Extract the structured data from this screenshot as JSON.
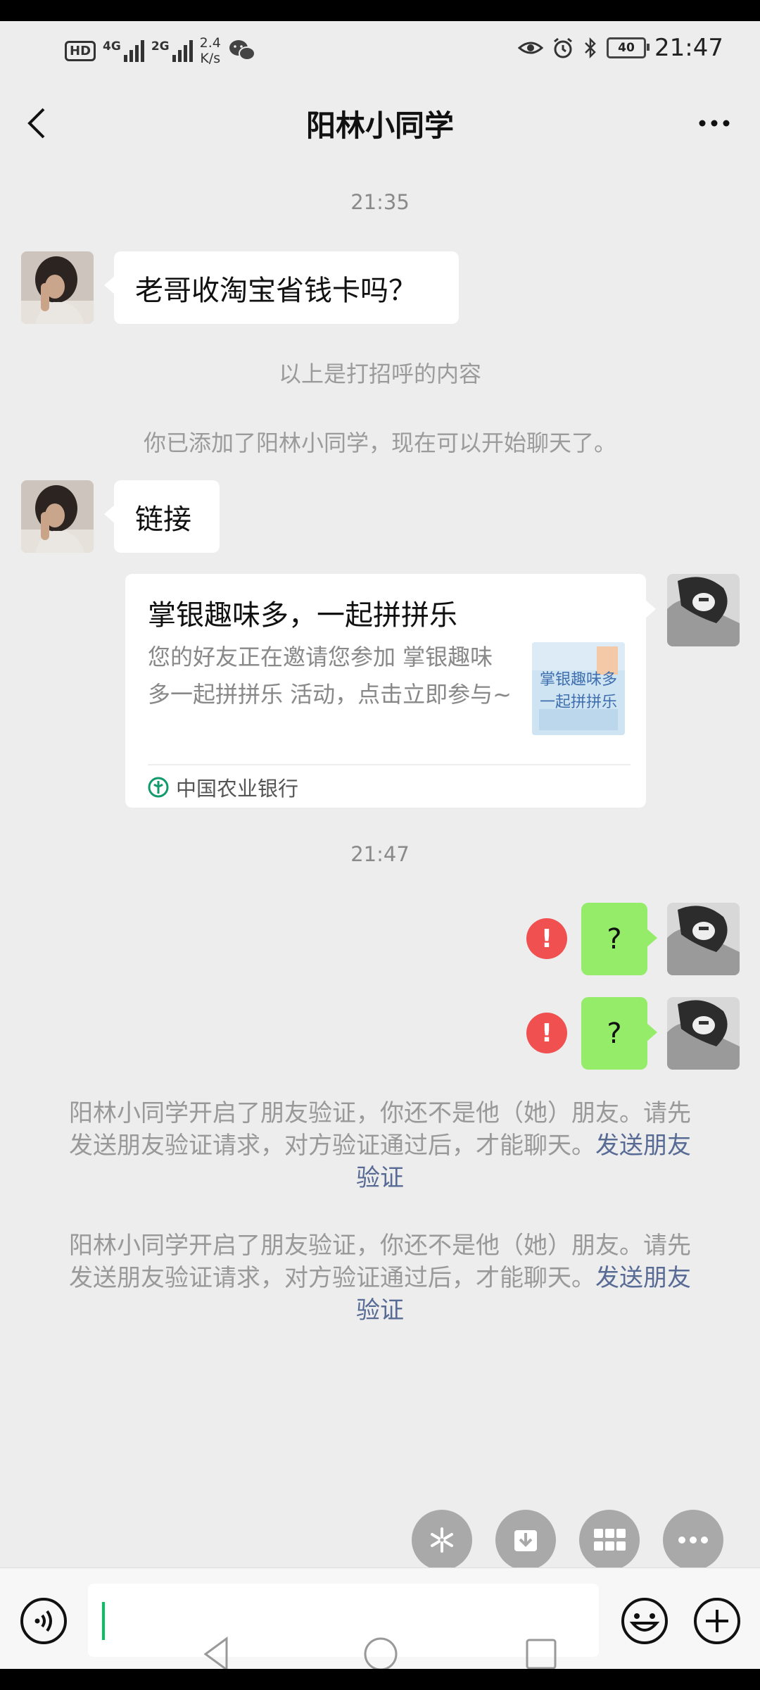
{
  "status_bar": {
    "hd": "HD",
    "net1": "4G",
    "net2": "2G",
    "speed_value": "2.4",
    "speed_unit": "K/s",
    "battery": "40",
    "time": "21:47"
  },
  "header": {
    "title": "阳林小同学"
  },
  "chat": {
    "timestamp1": "21:35",
    "msg1": "老哥收淘宝省钱卡吗？",
    "sys1": "以上是打招呼的内容",
    "sys2": "你已添加了阳林小同学，现在可以开始聊天了。",
    "msg2": "链接",
    "card": {
      "title": "掌银趣味多，一起拼拼乐",
      "description": "您的好友正在邀请您参加 掌银趣味多一起拼拼乐 活动，点击立即参与~",
      "thumb_line1": "掌银趣味多",
      "thumb_line2": "一起拼拼乐",
      "source": "中国农业银行"
    },
    "timestamp2": "21:47",
    "sent1": "?",
    "sent2": "?",
    "error_mark": "!",
    "verify_text": "阳林小同学开启了朋友验证，你还不是他（她）朋友。请先发送朋友验证请求，对方验证通过后，才能聊天。",
    "verify_link": "发送朋友验证"
  },
  "colors": {
    "background": "#ededed",
    "sent_bubble": "#95ec69",
    "error": "#f05050",
    "link": "#576b95"
  },
  "icons": {
    "quick_actions": [
      "sparkle-icon",
      "download-icon",
      "grid-icon",
      "more-icon"
    ],
    "input_bar": [
      "voice-icon",
      "emoji-icon",
      "plus-icon"
    ],
    "nav": [
      "nav-back-icon",
      "nav-home-icon",
      "nav-recents-icon"
    ]
  }
}
